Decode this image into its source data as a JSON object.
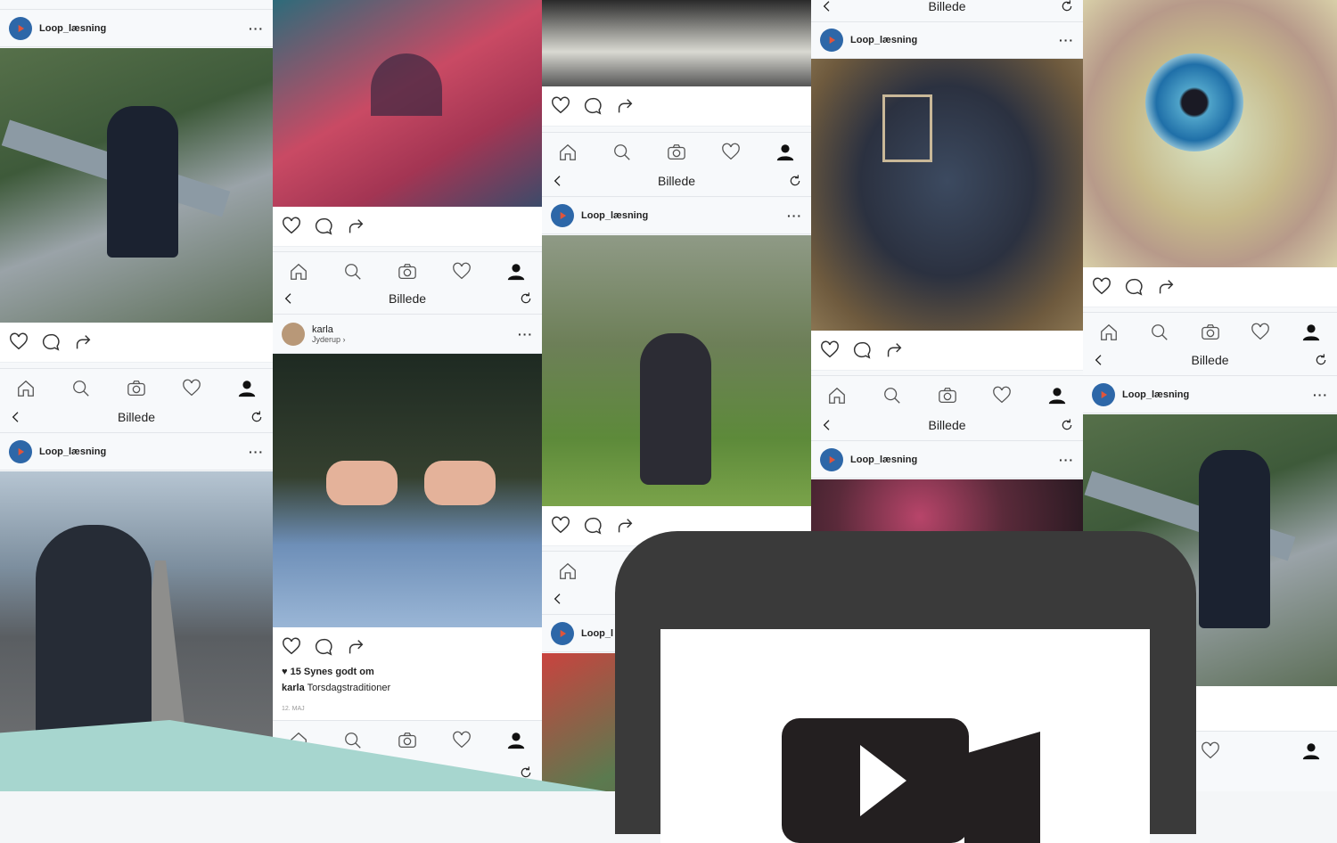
{
  "colors": {
    "accent": "#2d67a8",
    "teal": "#a7d6cf",
    "card": "#3a3a3a"
  },
  "username": "Loop_læsning",
  "more": "···",
  "screen_title": "Billede",
  "icons": [
    "heart-icon",
    "comment-icon",
    "share-icon",
    "home-icon",
    "search-icon",
    "camera-icon",
    "activity-heart-icon",
    "profile-icon",
    "back-icon",
    "refresh-icon",
    "video-camera-icon",
    "play-icon"
  ],
  "karla_post": {
    "user": "karla",
    "location": "Jyderup ›",
    "likes": "♥ 15 Synes godt om",
    "caption_user": "karla",
    "caption": "Torsdagstraditioner",
    "date": "12. MAJ"
  },
  "partial_username": "Loop_l"
}
